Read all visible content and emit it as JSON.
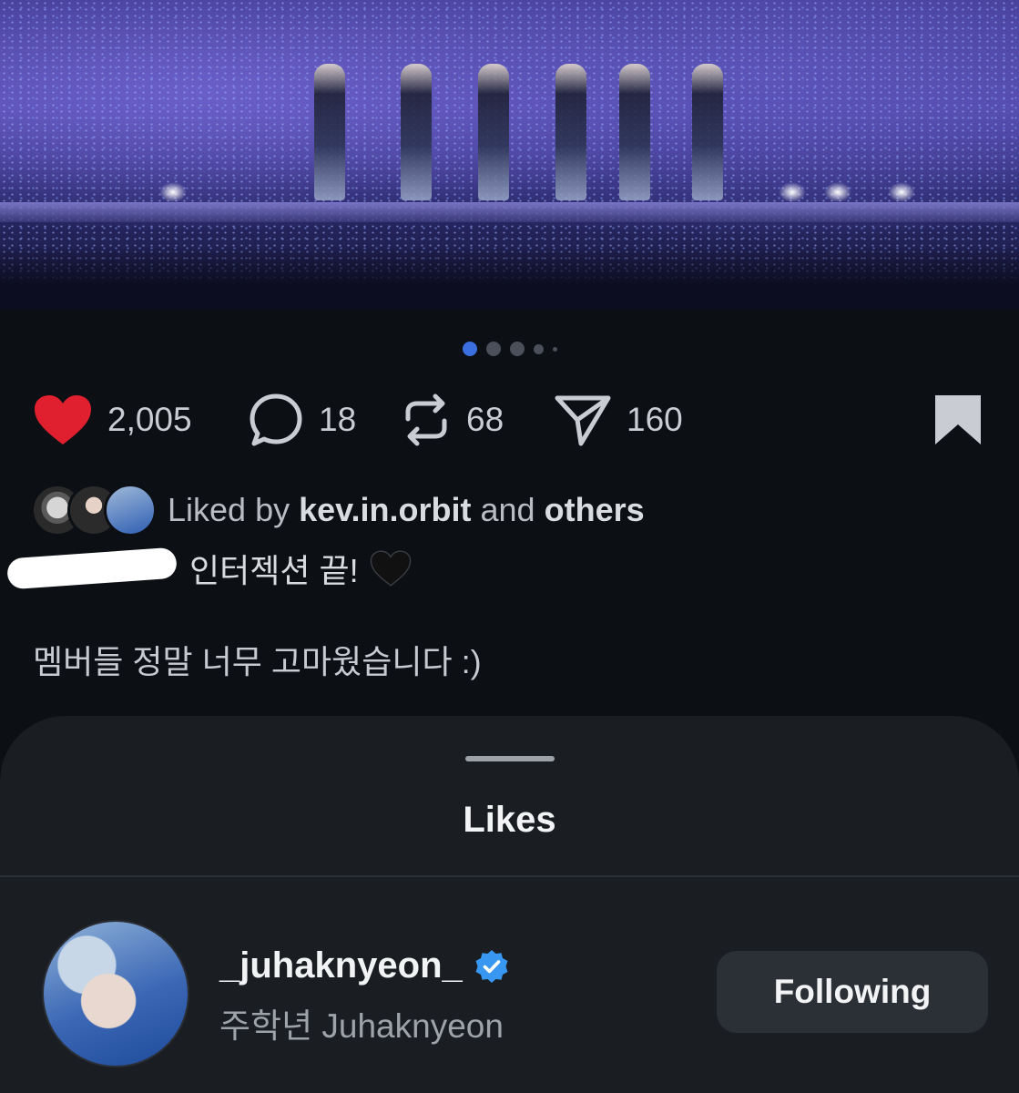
{
  "post": {
    "carousel": {
      "total_dots": 5,
      "active_index": 0
    },
    "actions": {
      "likes": "2,005",
      "comments": "18",
      "reposts": "68",
      "shares": "160",
      "liked": true,
      "like_color": "#e0202f",
      "icons": [
        "heart-icon",
        "comment-icon",
        "repost-icon",
        "share-icon",
        "bookmark-icon"
      ]
    },
    "liked_by": {
      "prefix": "Liked by",
      "user": "kev.in.orbit",
      "conjunction": "and",
      "others": "others"
    },
    "caption": {
      "line1": "인터젝션 끝!",
      "emoji": "black-heart-icon",
      "line2": "멤버들 정말 너무 고마웠습니다 :)"
    }
  },
  "likes_sheet": {
    "title": "Likes",
    "users": [
      {
        "username": "_juhaknyeon_",
        "verified": true,
        "full_name": "주학년 Juhaknyeon",
        "button_label": "Following"
      }
    ]
  },
  "colors": {
    "background": "#0c0f14",
    "sheet": "#1a1d22",
    "verified": "#3897f0",
    "active_dot": "#3b6fe0"
  }
}
